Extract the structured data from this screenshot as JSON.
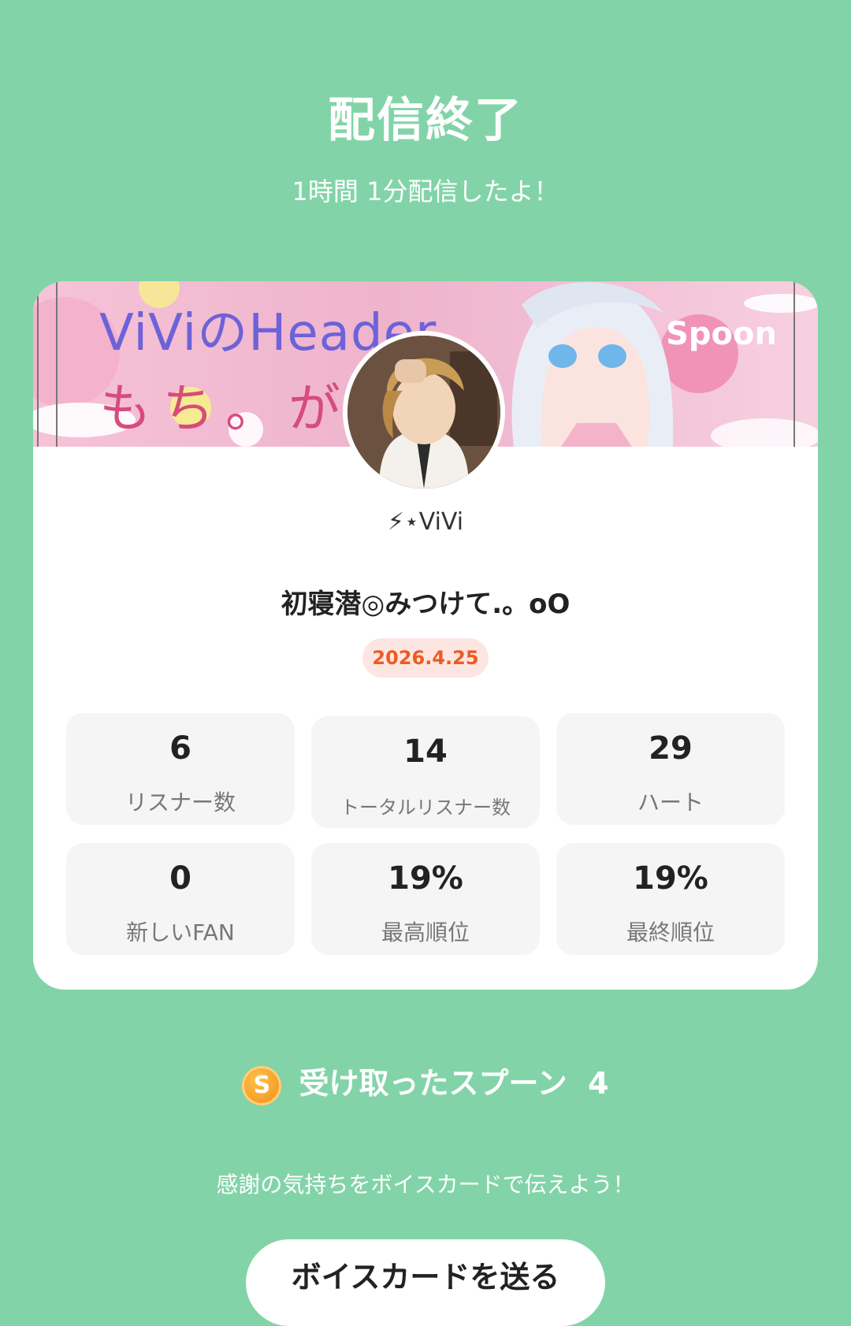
{
  "header": {
    "title": "配信終了",
    "duration_text": "1時間 1分配信したよ！"
  },
  "card": {
    "banner": {
      "line1": "ViViのHeader",
      "line2": "もち。が丁",
      "logo": "Spoon"
    },
    "username": "⚡︎⋆ViVi",
    "live_title": "初寝潜◎みつけて.。oO",
    "date": "2026.4.25",
    "stats": [
      {
        "value": "6",
        "label": "リスナー数"
      },
      {
        "value": "14",
        "label": "トータルリスナー数"
      },
      {
        "value": "29",
        "label": "ハート"
      },
      {
        "value": "0",
        "label": "新しいFAN"
      },
      {
        "value": "19%",
        "label": "最高順位"
      },
      {
        "value": "19%",
        "label": "最終順位"
      }
    ]
  },
  "spoons": {
    "icon": "spoon-coin-icon",
    "icon_letter": "S",
    "label": "受け取ったスプーン",
    "count": "4"
  },
  "thanks_text": "感謝の気持ちをボイスカードで伝えよう！",
  "voicecard_button": "ボイスカードを送る"
}
